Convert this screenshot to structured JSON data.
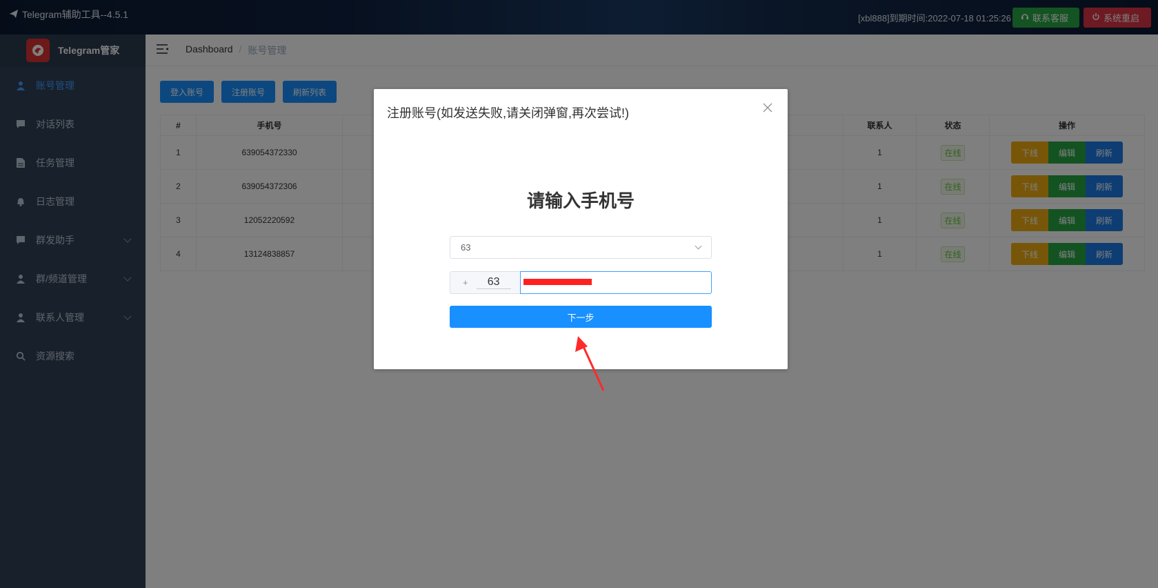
{
  "topbar": {
    "app_title": "Telegram辅助工具--4.5.1",
    "expire_text": "[xbl888]到期时间:2022-07-18 01:25:26",
    "contact_label": "联系客服",
    "restart_label": "系统重启"
  },
  "sidebar": {
    "brand": "Telegram管家",
    "items": [
      {
        "label": "账号管理",
        "icon": "user-icon",
        "active": true
      },
      {
        "label": "对话列表",
        "icon": "chat-icon"
      },
      {
        "label": "任务管理",
        "icon": "document-icon"
      },
      {
        "label": "日志管理",
        "icon": "bell-icon"
      },
      {
        "label": "群发助手",
        "icon": "chat-icon",
        "expandable": true
      },
      {
        "label": "群/频道管理",
        "icon": "user-icon",
        "expandable": true
      },
      {
        "label": "联系人管理",
        "icon": "user-icon",
        "expandable": true
      },
      {
        "label": "资源搜索",
        "icon": "search-icon"
      }
    ]
  },
  "breadcrumb": {
    "root": "Dashboard",
    "sep": "/",
    "current": "账号管理"
  },
  "actions": {
    "login": "登入账号",
    "register": "注册账号",
    "refresh": "刷新列表"
  },
  "table": {
    "headers": {
      "index": "#",
      "phone": "手机号",
      "contacts": "联系人",
      "status": "状态",
      "ops": "操作"
    },
    "rows": [
      {
        "index": "1",
        "phone": "639054372330",
        "contacts": "1",
        "status": "在线"
      },
      {
        "index": "2",
        "phone": "639054372306",
        "contacts": "1",
        "status": "在线"
      },
      {
        "index": "3",
        "phone": "12052220592",
        "contacts": "1",
        "status": "在线"
      },
      {
        "index": "4",
        "phone": "13124838857",
        "contacts": "1",
        "status": "在线"
      }
    ],
    "op_labels": {
      "offline": "下线",
      "edit": "编辑",
      "refresh": "刷新"
    }
  },
  "dialog": {
    "title": "注册账号(如发送失败,请关闭弹窗,再次尝试!)",
    "heading": "请输入手机号",
    "country_select": "63",
    "prefix_sign": "+",
    "prefix_code": "63",
    "next_label": "下一步"
  },
  "colors": {
    "primary": "#1890ff",
    "success": "#28a745",
    "danger": "#dc3545",
    "warning": "#f0ad12",
    "sidebar": "#304156"
  }
}
